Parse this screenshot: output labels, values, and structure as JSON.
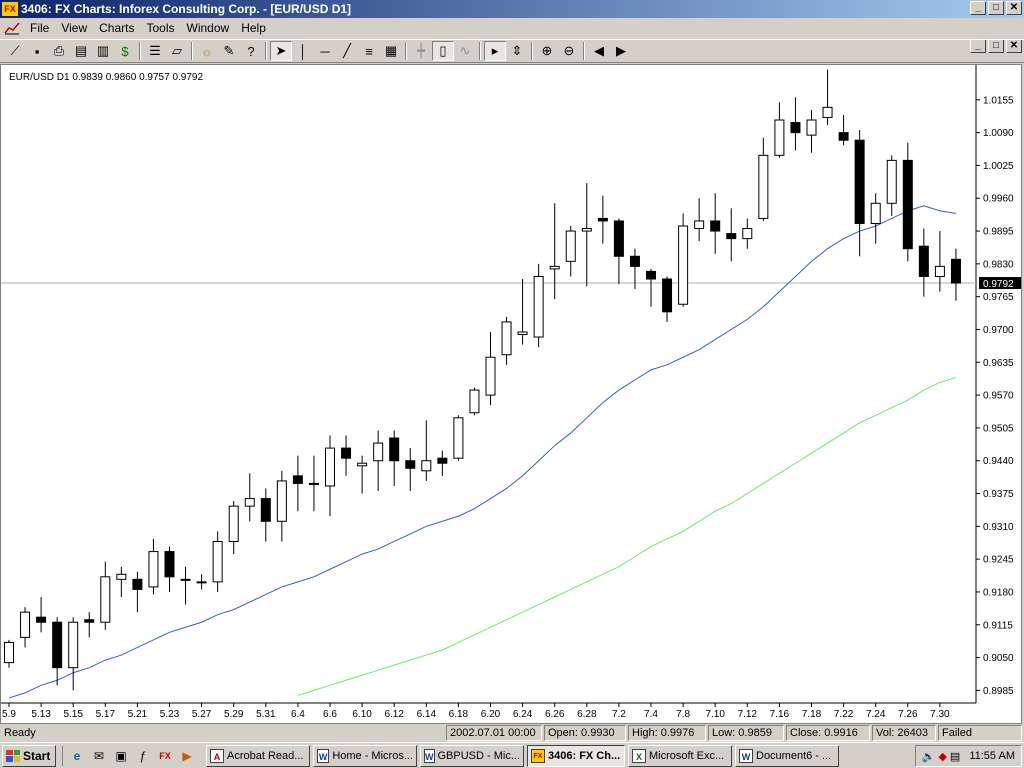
{
  "window": {
    "title": "3406: FX Charts: Inforex Consulting Corp. - [EUR/USD D1]",
    "app_badge": "FX",
    "btn_min": "_",
    "btn_max": "□",
    "btn_close": "✕"
  },
  "menu": [
    "File",
    "View",
    "Charts",
    "Tools",
    "Window",
    "Help"
  ],
  "toolbar": [
    "line-chart-icon",
    "save-icon",
    "print-icon",
    "properties-icon",
    "clipboard-icon",
    "dollar-icon",
    "sep",
    "list-icon",
    "open-icon",
    "sep",
    "sun-icon",
    "tools-icon",
    "help-icon",
    "sep",
    "cursor-icon",
    "vertical-line-icon",
    "horizontal-line-icon",
    "trendline-icon",
    "channel-icon",
    "fibonacci-icon",
    "sep",
    "bar-chart-icon",
    "candle-chart-icon",
    "line-series-icon",
    "sep",
    "shift-icon",
    "autoscroll-icon",
    "sep",
    "zoom-in-icon",
    "zoom-out-icon",
    "sep",
    "scroll-left-icon",
    "scroll-right-icon"
  ],
  "chart_header": "EUR/USD D1   0.9839  0.9860  0.9757  0.9792",
  "chart_data": {
    "type": "candlestick",
    "symbol": "EUR/USD",
    "timeframe": "D1",
    "last_price": "0.9792",
    "last_value": 0.9792,
    "ylim": [
      0.896,
      1.022
    ],
    "y_ticks": [
      "1.0155",
      "1.0090",
      "1.0025",
      "0.9960",
      "0.9895",
      "0.9830",
      "0.9765",
      "0.9700",
      "0.9635",
      "0.9570",
      "0.9505",
      "0.9440",
      "0.9375",
      "0.9310",
      "0.9245",
      "0.9180",
      "0.9115",
      "0.9050",
      "0.8985"
    ],
    "x_ticks": [
      "5.9",
      "5.13",
      "5.15",
      "5.17",
      "5.21",
      "5.23",
      "5.27",
      "5.29",
      "5.31",
      "6.4",
      "6.6",
      "6.10",
      "6.12",
      "6.14",
      "6.18",
      "6.20",
      "6.24",
      "6.26",
      "6.28",
      "7.2",
      "7.4",
      "7.8",
      "7.10",
      "7.12",
      "7.16",
      "7.18",
      "7.22",
      "7.24",
      "7.26",
      "7.30"
    ],
    "candles": [
      [
        0.904,
        0.908,
        0.903,
        0.9085
      ],
      [
        0.909,
        0.914,
        0.907,
        0.915
      ],
      [
        0.913,
        0.912,
        0.91,
        0.917
      ],
      [
        0.912,
        0.903,
        0.8995,
        0.913
      ],
      [
        0.903,
        0.912,
        0.8985,
        0.913
      ],
      [
        0.9125,
        0.912,
        0.909,
        0.914
      ],
      [
        0.912,
        0.921,
        0.9105,
        0.924
      ],
      [
        0.9205,
        0.9215,
        0.917,
        0.923
      ],
      [
        0.9205,
        0.9185,
        0.914,
        0.922
      ],
      [
        0.919,
        0.926,
        0.9175,
        0.9285
      ],
      [
        0.926,
        0.921,
        0.918,
        0.927
      ],
      [
        0.9205,
        0.9205,
        0.9155,
        0.923
      ],
      [
        0.92,
        0.92,
        0.9185,
        0.9215
      ],
      [
        0.92,
        0.928,
        0.918,
        0.93
      ],
      [
        0.928,
        0.935,
        0.9255,
        0.936
      ],
      [
        0.935,
        0.9365,
        0.932,
        0.9415
      ],
      [
        0.9365,
        0.932,
        0.928,
        0.9385
      ],
      [
        0.932,
        0.94,
        0.928,
        0.942
      ],
      [
        0.941,
        0.9395,
        0.934,
        0.945
      ],
      [
        0.9395,
        0.9395,
        0.934,
        0.945
      ],
      [
        0.939,
        0.9465,
        0.933,
        0.949
      ],
      [
        0.9465,
        0.9445,
        0.941,
        0.949
      ],
      [
        0.943,
        0.9435,
        0.9375,
        0.945
      ],
      [
        0.944,
        0.9475,
        0.938,
        0.95
      ],
      [
        0.9485,
        0.944,
        0.939,
        0.95
      ],
      [
        0.944,
        0.9425,
        0.938,
        0.9465
      ],
      [
        0.942,
        0.944,
        0.94,
        0.952
      ],
      [
        0.9445,
        0.9435,
        0.941,
        0.946
      ],
      [
        0.9445,
        0.9525,
        0.944,
        0.953
      ],
      [
        0.9535,
        0.958,
        0.953,
        0.9585
      ],
      [
        0.957,
        0.9645,
        0.955,
        0.9695
      ],
      [
        0.965,
        0.9715,
        0.963,
        0.9725
      ],
      [
        0.969,
        0.9695,
        0.967,
        0.98
      ],
      [
        0.9685,
        0.9805,
        0.9665,
        0.983
      ],
      [
        0.982,
        0.9825,
        0.976,
        0.995
      ],
      [
        0.9835,
        0.9895,
        0.9805,
        0.9905
      ],
      [
        0.9895,
        0.99,
        0.9785,
        0.999
      ],
      [
        0.992,
        0.9915,
        0.987,
        0.9965
      ],
      [
        0.9915,
        0.9845,
        0.979,
        0.992
      ],
      [
        0.9845,
        0.9825,
        0.978,
        0.986
      ],
      [
        0.9815,
        0.98,
        0.9745,
        0.982
      ],
      [
        0.98,
        0.9735,
        0.9715,
        0.9805
      ],
      [
        0.975,
        0.9905,
        0.9745,
        0.993
      ],
      [
        0.99,
        0.9915,
        0.9875,
        0.996
      ],
      [
        0.9915,
        0.9895,
        0.985,
        0.997
      ],
      [
        0.989,
        0.988,
        0.9835,
        0.994
      ],
      [
        0.988,
        0.99,
        0.986,
        0.992
      ],
      [
        0.992,
        1.0045,
        0.9915,
        1.008
      ],
      [
        1.0045,
        1.0115,
        1.004,
        1.015
      ],
      [
        1.011,
        1.009,
        1.0055,
        1.016
      ],
      [
        1.0085,
        1.0115,
        1.005,
        1.0135
      ],
      [
        1.012,
        1.014,
        1.0105,
        1.0215
      ],
      [
        1.009,
        1.0075,
        1.0065,
        1.0125
      ],
      [
        1.0075,
        0.991,
        0.9845,
        1.0095
      ],
      [
        0.991,
        0.995,
        0.987,
        0.997
      ],
      [
        0.995,
        1.0035,
        0.9925,
        1.0045
      ],
      [
        1.0035,
        0.986,
        0.9835,
        1.007
      ],
      [
        0.9865,
        0.9805,
        0.9765,
        0.99
      ],
      [
        0.9805,
        0.9825,
        0.9775,
        0.9895
      ],
      [
        0.9839,
        0.9792,
        0.9757,
        0.986
      ]
    ],
    "ma_blue": [
      0.897,
      0.898,
      0.8995,
      0.9005,
      0.902,
      0.903,
      0.9045,
      0.9055,
      0.907,
      0.9085,
      0.91,
      0.911,
      0.912,
      0.9135,
      0.9145,
      0.916,
      0.9175,
      0.919,
      0.92,
      0.921,
      0.9225,
      0.924,
      0.9255,
      0.9265,
      0.928,
      0.9295,
      0.931,
      0.932,
      0.933,
      0.9345,
      0.9365,
      0.9385,
      0.941,
      0.944,
      0.947,
      0.9495,
      0.9525,
      0.9555,
      0.958,
      0.96,
      0.962,
      0.963,
      0.9645,
      0.966,
      0.968,
      0.97,
      0.972,
      0.9745,
      0.9775,
      0.9805,
      0.9835,
      0.986,
      0.988,
      0.9895,
      0.9905,
      0.992,
      0.9935,
      0.9945,
      0.9935,
      0.993
    ],
    "ma_green": [
      null,
      null,
      null,
      null,
      null,
      null,
      null,
      null,
      null,
      null,
      null,
      null,
      null,
      null,
      null,
      null,
      null,
      null,
      0.8975,
      0.8985,
      0.8995,
      0.9005,
      0.9015,
      0.9025,
      0.9035,
      0.9045,
      0.9055,
      0.9065,
      0.908,
      0.9095,
      0.911,
      0.9125,
      0.914,
      0.9155,
      0.917,
      0.9185,
      0.92,
      0.9215,
      0.923,
      0.925,
      0.927,
      0.9285,
      0.93,
      0.932,
      0.934,
      0.9355,
      0.9375,
      0.9395,
      0.9415,
      0.9435,
      0.9455,
      0.9475,
      0.9495,
      0.9515,
      0.953,
      0.9545,
      0.956,
      0.958,
      0.9595,
      0.9605
    ]
  },
  "status": {
    "ready": "Ready",
    "time": "2002.07.01 00:00",
    "open": "Open: 0.9930",
    "high": "High: 0.9976",
    "low": "Low: 0.9859",
    "close": "Close: 0.9916",
    "vol": "Vol: 26403",
    "conn": "Failed"
  },
  "taskbar": {
    "start": "Start",
    "tasks": [
      {
        "label": "Acrobat Read...",
        "icon": "A"
      },
      {
        "label": "Home - Micros...",
        "icon": "W"
      },
      {
        "label": "GBPUSD - Mic...",
        "icon": "W"
      },
      {
        "label": "3406: FX Ch...",
        "icon": "FX",
        "active": true
      },
      {
        "label": "Microsoft Exc...",
        "icon": "X"
      },
      {
        "label": "Document6 - ...",
        "icon": "W"
      }
    ],
    "clock": "11:55 AM"
  }
}
